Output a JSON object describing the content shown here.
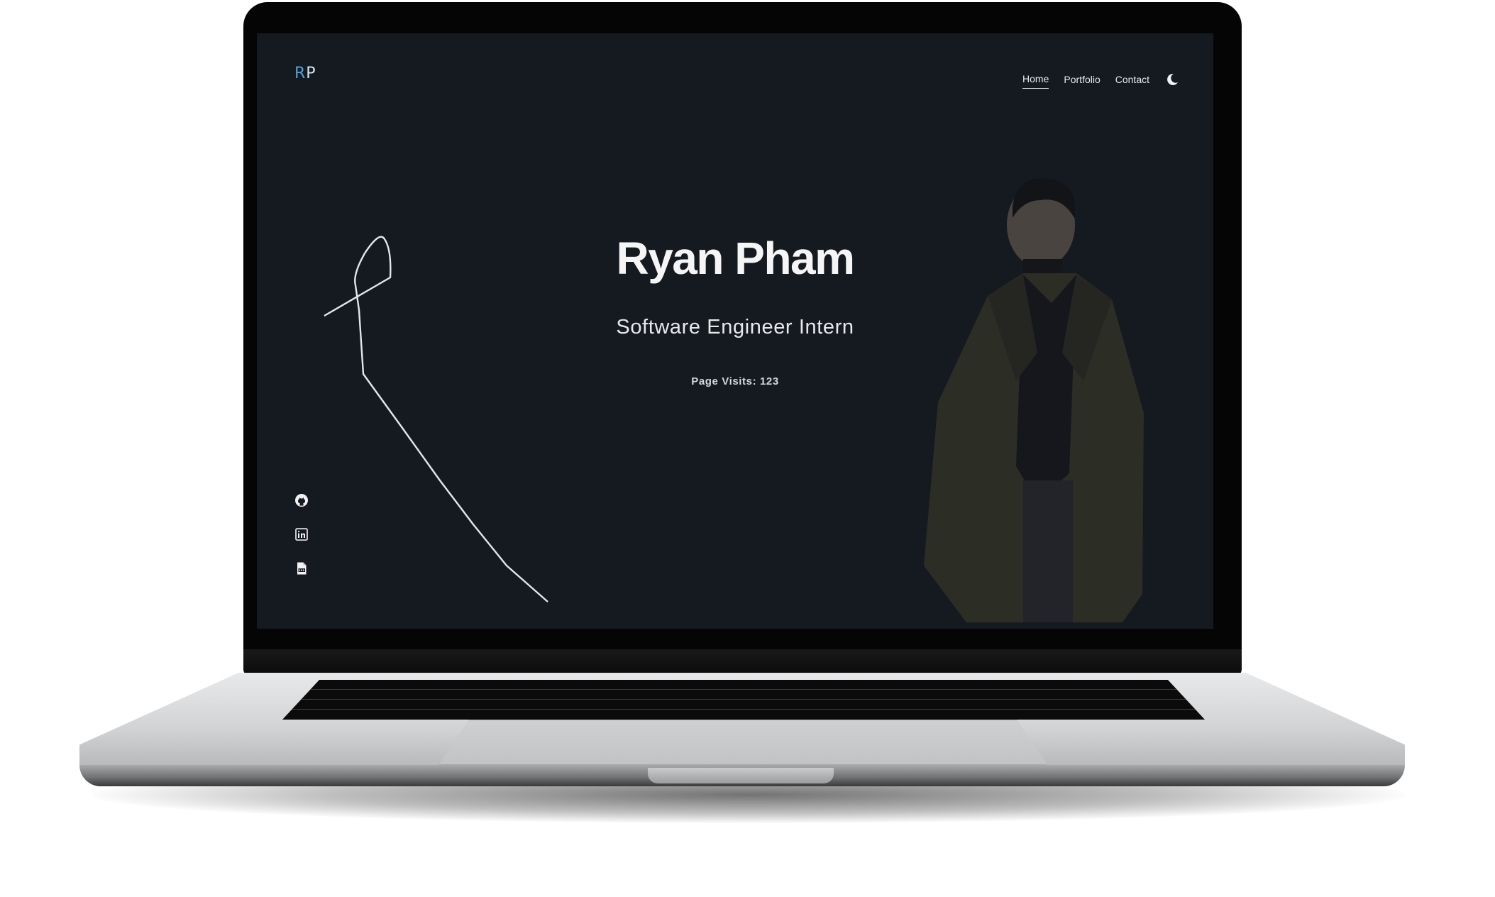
{
  "site": {
    "logo": {
      "first": "R",
      "second": "P"
    },
    "nav": {
      "items": [
        {
          "label": "Home",
          "active": true
        },
        {
          "label": "Portfolio",
          "active": false
        },
        {
          "label": "Contact",
          "active": false
        }
      ],
      "theme_toggle_icon": "moon-icon"
    },
    "hero": {
      "name": "Ryan Pham",
      "role": "Software Engineer Intern",
      "visits": "Page Visits: 123"
    },
    "socials": [
      {
        "icon": "github-icon"
      },
      {
        "icon": "linkedin-icon"
      },
      {
        "icon": "pdf-icon"
      }
    ]
  },
  "colors": {
    "background": "#151a21",
    "accent": "#4da3d9",
    "text": "#f5f5f5"
  }
}
